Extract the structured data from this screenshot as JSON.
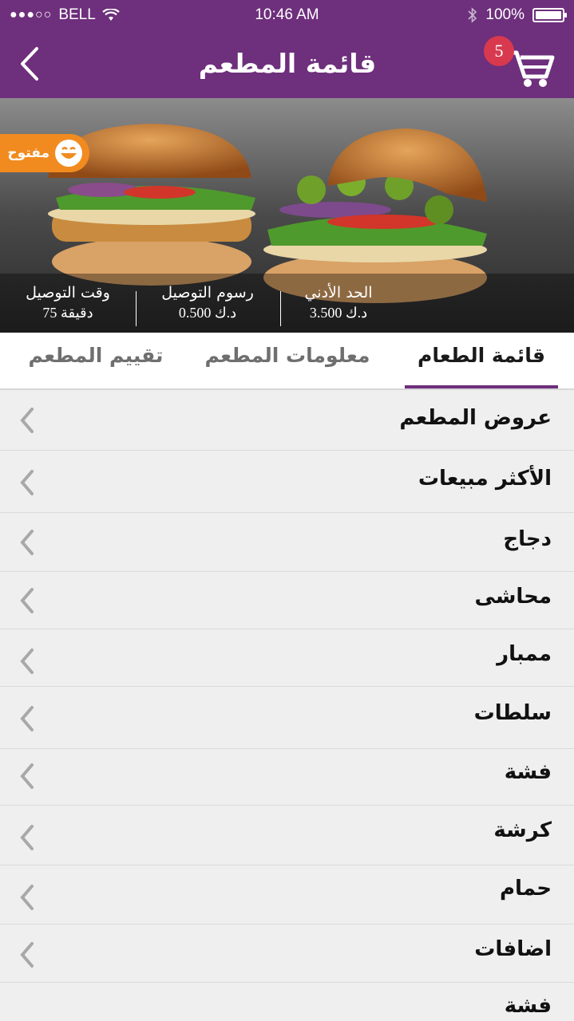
{
  "status_bar": {
    "carrier": "BELL",
    "signal_dots": "●●●○○",
    "time": "10:46 AM",
    "battery": "100%"
  },
  "header": {
    "title": "قائمة المطعم",
    "cart_count": "5",
    "accent": "#6e2f7c"
  },
  "hero": {
    "open_label": "مفتوح",
    "info": [
      {
        "label": "الحد الأدني",
        "value": "3.500 د.ك"
      },
      {
        "label": "رسوم التوصيل",
        "value": "0.500 د.ك"
      },
      {
        "label": "وقت التوصيل",
        "value": "75 دقيقة"
      }
    ]
  },
  "tabs": [
    {
      "label": "قائمة الطعام",
      "active": true
    },
    {
      "label": "معلومات المطعم",
      "active": false
    },
    {
      "label": "تقييم المطعم",
      "active": false
    }
  ],
  "menu": [
    {
      "label": "عروض المطعم"
    },
    {
      "label": "الأكثر مبيعات"
    },
    {
      "label": "دجاج"
    },
    {
      "label": "محاشى"
    },
    {
      "label": "ممبار"
    },
    {
      "label": "سلطات"
    },
    {
      "label": "فشة"
    },
    {
      "label": "كرشة"
    },
    {
      "label": "حمام"
    },
    {
      "label": "اضافات"
    },
    {
      "label": "فشة"
    }
  ],
  "icons": [
    "back-arrow-icon",
    "cart-icon",
    "smile-icon",
    "chevron-left-icon",
    "wifi-icon",
    "bluetooth-icon",
    "battery-icon"
  ]
}
